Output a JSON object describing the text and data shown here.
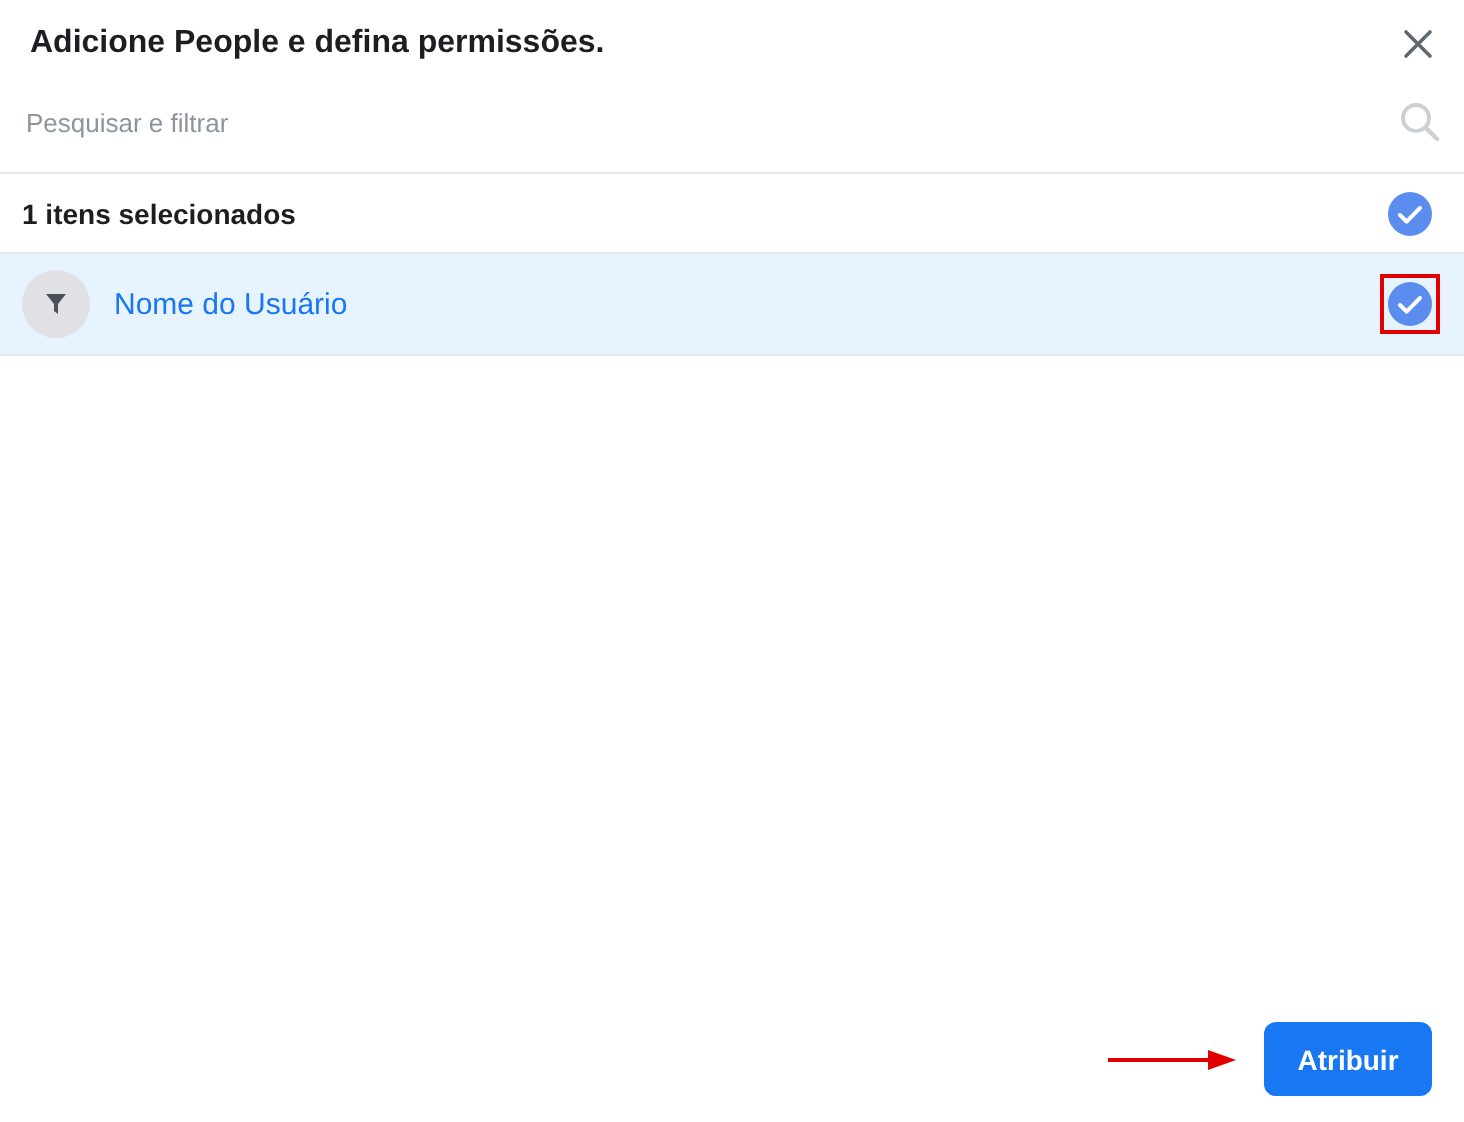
{
  "dialog": {
    "title": "Adicione People e defina permissões."
  },
  "search": {
    "placeholder": "Pesquisar e filtrar"
  },
  "summary": {
    "label": "1 itens selecionados",
    "checked": true
  },
  "people": [
    {
      "name": "Nome do Usuário",
      "selected": true,
      "highlighted": true
    }
  ],
  "submit": {
    "label": "Atribuir",
    "pointed": true
  }
}
